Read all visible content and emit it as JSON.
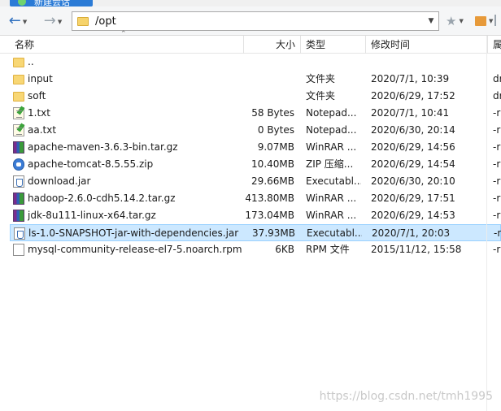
{
  "window": {
    "tab_title": "新建会话"
  },
  "address_bar": {
    "path": "/opt"
  },
  "columns": {
    "name": "名称",
    "size": "大小",
    "type": "类型",
    "modified": "修改时间",
    "perm": "属"
  },
  "files": [
    {
      "name": "..",
      "size": "",
      "type": "",
      "modified": "",
      "perm": "",
      "icon": "folder-icon"
    },
    {
      "name": "input",
      "size": "",
      "type": "文件夹",
      "modified": "2020/7/1, 10:39",
      "perm": "dr",
      "icon": "folder-icon"
    },
    {
      "name": "soft",
      "size": "",
      "type": "文件夹",
      "modified": "2020/6/29, 17:52",
      "perm": "dr",
      "icon": "folder-icon"
    },
    {
      "name": "1.txt",
      "size": "58 Bytes",
      "type": "Notepad...",
      "modified": "2020/7/1, 10:41",
      "perm": "-r",
      "icon": "text-file-icon"
    },
    {
      "name": "aa.txt",
      "size": "0 Bytes",
      "type": "Notepad...",
      "modified": "2020/6/30, 20:14",
      "perm": "-r",
      "icon": "text-file-icon"
    },
    {
      "name": "apache-maven-3.6.3-bin.tar.gz",
      "size": "9.07MB",
      "type": "WinRAR ...",
      "modified": "2020/6/29, 14:56",
      "perm": "-r",
      "icon": "winrar-archive-icon"
    },
    {
      "name": "apache-tomcat-8.5.55.zip",
      "size": "10.40MB",
      "type": "ZIP 压缩...",
      "modified": "2020/6/29, 14:54",
      "perm": "-r",
      "icon": "zip-archive-icon"
    },
    {
      "name": "download.jar",
      "size": "29.66MB",
      "type": "Executabl...",
      "modified": "2020/6/30, 20:10",
      "perm": "-r",
      "icon": "jar-file-icon"
    },
    {
      "name": "hadoop-2.6.0-cdh5.14.2.tar.gz",
      "size": "413.80MB",
      "type": "WinRAR ...",
      "modified": "2020/6/29, 17:51",
      "perm": "-r",
      "icon": "winrar-archive-icon"
    },
    {
      "name": "jdk-8u111-linux-x64.tar.gz",
      "size": "173.04MB",
      "type": "WinRAR ...",
      "modified": "2020/6/29, 14:53",
      "perm": "-r",
      "icon": "winrar-archive-icon"
    },
    {
      "name": "ls-1.0-SNAPSHOT-jar-with-dependencies.jar",
      "size": "37.93MB",
      "type": "Executabl...",
      "modified": "2020/7/1, 20:03",
      "perm": "-r",
      "icon": "jar-file-icon",
      "selected": true
    },
    {
      "name": "mysql-community-release-el7-5.noarch.rpm",
      "size": "6KB",
      "type": "RPM 文件",
      "modified": "2015/11/12, 15:58",
      "perm": "-r",
      "icon": "rpm-file-icon"
    }
  ],
  "watermark": "https://blog.csdn.net/tmh1995",
  "colors": {
    "selection_bg": "#cce8ff",
    "selection_border": "#99d1ff",
    "back_arrow": "#2e6fbf",
    "folder": "#f8d775"
  }
}
